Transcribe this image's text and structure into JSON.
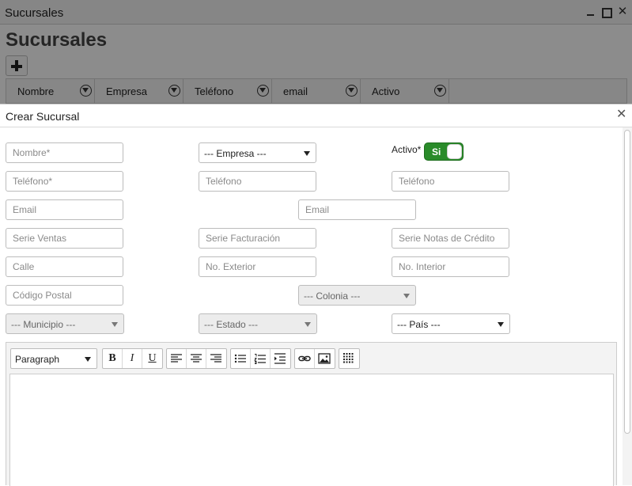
{
  "window": {
    "title": "Sucursales"
  },
  "page": {
    "heading": "Sucursales"
  },
  "grid": {
    "columns": [
      "Nombre",
      "Empresa",
      "Teléfono",
      "email",
      "Activo"
    ]
  },
  "modal": {
    "title": "Crear Sucursal",
    "fields": {
      "nombre": "Nombre*",
      "empresa": "--- Empresa ---",
      "activo_label": "Activo*",
      "activo_value": "Si",
      "telefono1": "Teléfono*",
      "telefono2": "Teléfono",
      "telefono3": "Teléfono",
      "email1": "Email",
      "email2": "Email",
      "serie_ventas": "Serie Ventas",
      "serie_facturacion": "Serie Facturación",
      "serie_notas": "Serie Notas de Crédito",
      "calle": "Calle",
      "no_exterior": "No. Exterior",
      "no_interior": "No. Interior",
      "codigo_postal": "Código Postal",
      "colonia": "--- Colonia ---",
      "municipio": "--- Municipio ---",
      "estado": "--- Estado ---",
      "pais": "--- País ---"
    },
    "editor": {
      "block_format": "Paragraph",
      "bold": "B",
      "italic": "I",
      "underline": "U"
    }
  },
  "colors": {
    "toggle_on": "#2a8b2a",
    "overlay": "rgba(0,0,0,0.45)"
  },
  "icons": [
    "minimize-icon",
    "maximize-icon",
    "close-icon",
    "plus-icon",
    "filter-icon",
    "chevron-down-icon",
    "align-left-icon",
    "align-center-icon",
    "align-right-icon",
    "bullet-list-icon",
    "numbered-list-icon",
    "indent-icon",
    "link-icon",
    "image-icon",
    "table-icon"
  ]
}
